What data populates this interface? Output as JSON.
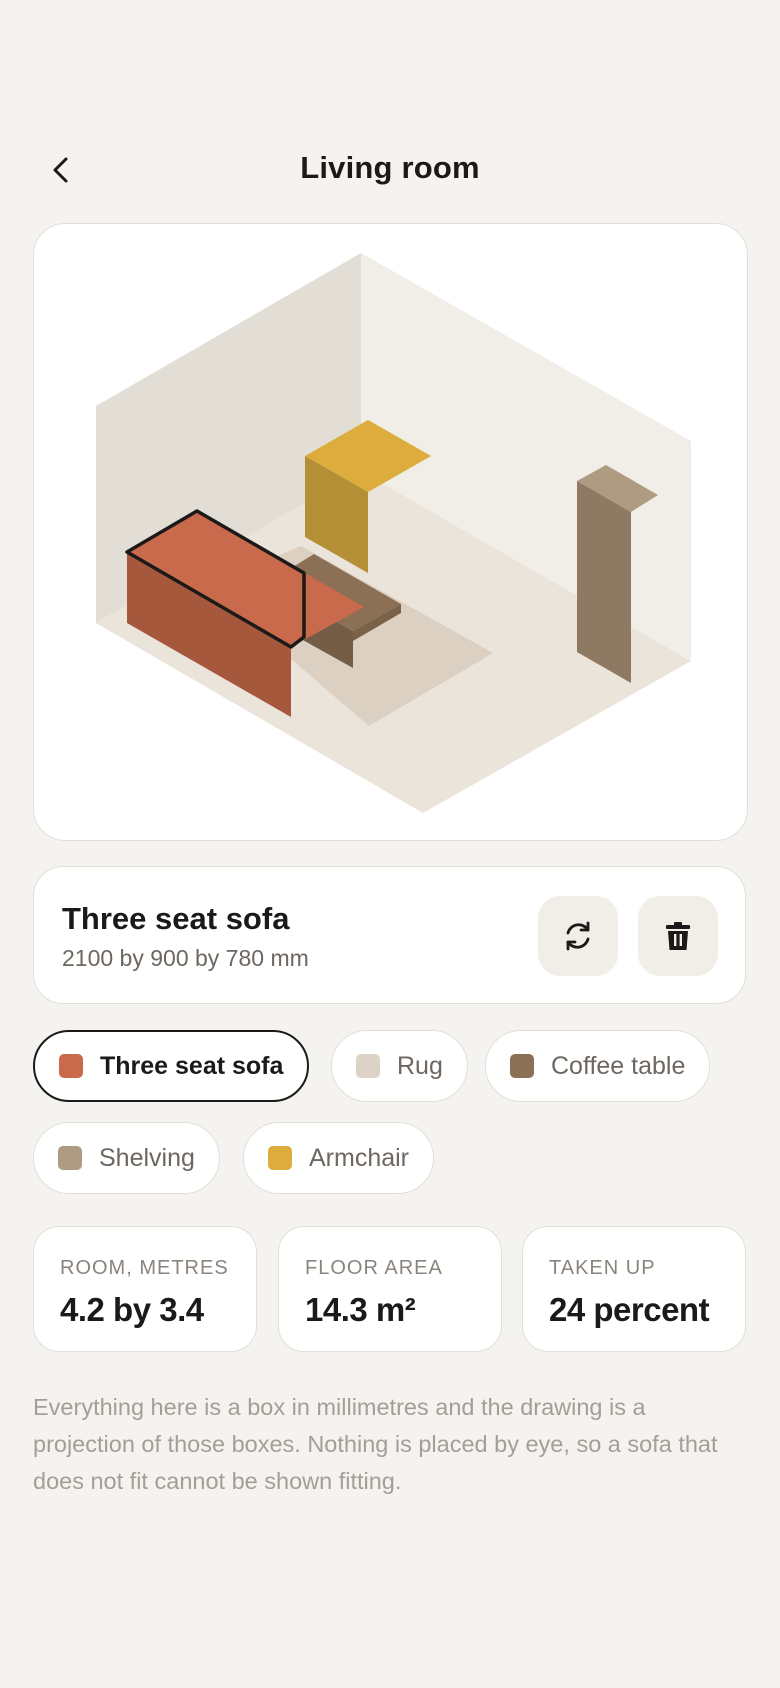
{
  "header": {
    "title": "Living room"
  },
  "selected": {
    "name": "Three seat sofa",
    "dimensions": "2100 by 900 by 780 mm"
  },
  "items": [
    {
      "label": "Three seat sofa",
      "color": "#c96a4c",
      "selected": true
    },
    {
      "label": "Rug",
      "color": "#dcd2c5",
      "selected": false
    },
    {
      "label": "Coffee table",
      "color": "#8c7055",
      "selected": false
    },
    {
      "label": "Shelving",
      "color": "#ae9b82",
      "selected": false
    },
    {
      "label": "Armchair",
      "color": "#dcac3c",
      "selected": false
    }
  ],
  "stats": [
    {
      "label": "Room, metres",
      "value": "4.2 by 3.4"
    },
    {
      "label": "Floor area",
      "value": "14.3 m²"
    },
    {
      "label": "Taken up",
      "value": "24 percent"
    }
  ],
  "footnote": "Everything here is a box in millimetres and the drawing is a projection of those boxes. Nothing is placed by eye, so a sofa that does not fit cannot be shown fitting.",
  "icons": {
    "back": "chevron-left-icon",
    "rotate": "rotate-icon",
    "delete": "trash-icon"
  },
  "colors": {
    "background": "#f5f3ef",
    "card": "#ffffff",
    "selection_outline": "#1c1a18"
  }
}
